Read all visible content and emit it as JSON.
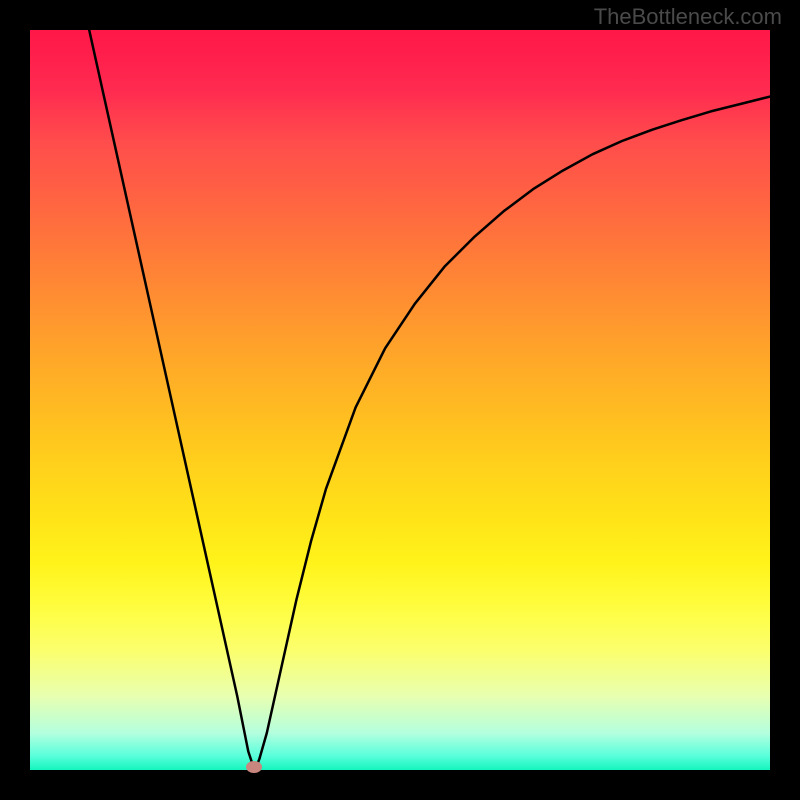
{
  "watermark": "TheBottleneck.com",
  "chart_data": {
    "type": "line",
    "title": "",
    "xlabel": "",
    "ylabel": "",
    "xlim": [
      0,
      100
    ],
    "ylim": [
      0,
      100
    ],
    "grid": false,
    "legend": false,
    "background": "rainbow-gradient",
    "series": [
      {
        "name": "bottleneck-curve",
        "color": "#000000",
        "x": [
          8,
          10,
          12,
          14,
          16,
          18,
          20,
          22,
          24,
          26,
          28,
          29,
          29.5,
          30,
          30.3,
          30.6,
          31,
          32,
          34,
          36,
          38,
          40,
          44,
          48,
          52,
          56,
          60,
          64,
          68,
          72,
          76,
          80,
          84,
          88,
          92,
          96,
          100
        ],
        "y": [
          100,
          91,
          82,
          73,
          64,
          55,
          46,
          37,
          28,
          19,
          10,
          5,
          2.5,
          1,
          0.4,
          0.5,
          1.5,
          5,
          14,
          23,
          31,
          38,
          49,
          57,
          63,
          68,
          72,
          75.5,
          78.5,
          81,
          83.2,
          85,
          86.5,
          87.8,
          89,
          90,
          91
        ]
      }
    ],
    "marker": {
      "x": 30.3,
      "y": 0.4,
      "color": "#c9867e"
    }
  }
}
